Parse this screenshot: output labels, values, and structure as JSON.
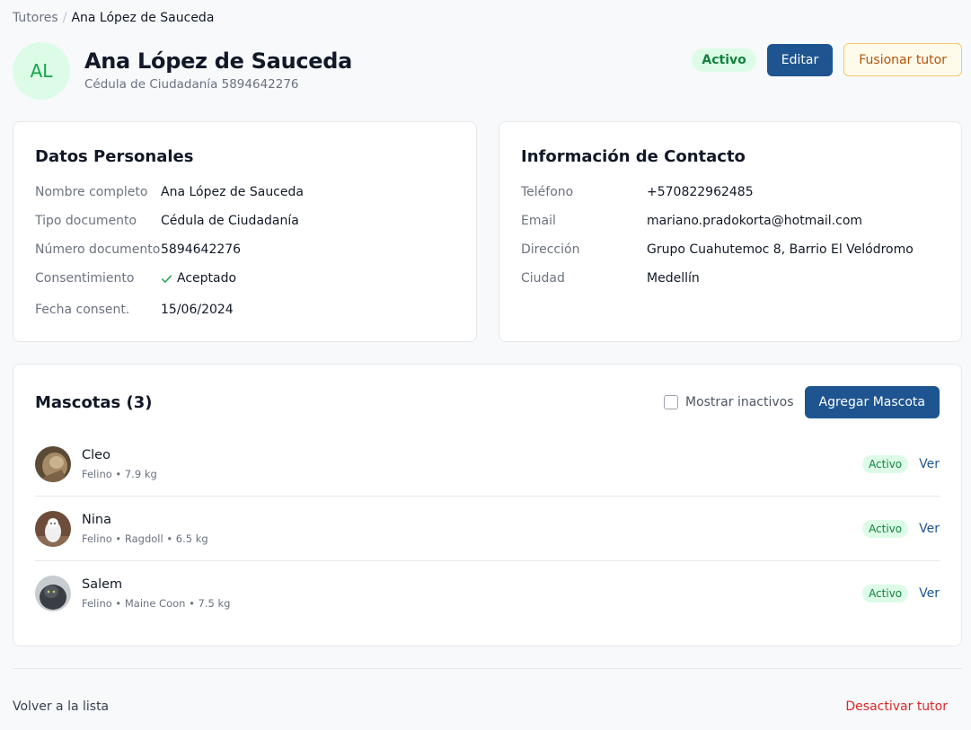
{
  "breadcrumb": {
    "parent": "Tutores",
    "separator": "/",
    "current": "Ana López de Sauceda"
  },
  "header": {
    "initials": "AL",
    "name": "Ana López de Sauceda",
    "subtitle": "Cédula de Ciudadanía 5894642276",
    "status": "Activo",
    "edit_label": "Editar",
    "merge_label": "Fusionar tutor"
  },
  "personal": {
    "title": "Datos Personales",
    "rows": [
      {
        "label": "Nombre completo",
        "value": "Ana López de Sauceda"
      },
      {
        "label": "Tipo documento",
        "value": "Cédula de Ciudadanía"
      },
      {
        "label": "Número documento",
        "value": "5894642276"
      },
      {
        "label": "Consentimiento",
        "value": "Aceptado"
      },
      {
        "label": "Fecha consent.",
        "value": "15/06/2024"
      }
    ]
  },
  "contact": {
    "title": "Información de Contacto",
    "rows": [
      {
        "label": "Teléfono",
        "value": "+570822962485"
      },
      {
        "label": "Email",
        "value": "mariano.pradokorta@hotmail.com"
      },
      {
        "label": "Dirección",
        "value": "Grupo Cuahutemoc 8, Barrio El Velódromo"
      },
      {
        "label": "Ciudad",
        "value": "Medellín"
      }
    ]
  },
  "pets": {
    "title": "Mascotas (3)",
    "show_inactive_label": "Mostrar inactivos",
    "add_label": "Agregar Mascota",
    "items": [
      {
        "name": "Cleo",
        "meta": "Felino • 7.9 kg",
        "status": "Activo",
        "action": "Ver"
      },
      {
        "name": "Nina",
        "meta": "Felino • Ragdoll • 6.5 kg",
        "status": "Activo",
        "action": "Ver"
      },
      {
        "name": "Salem",
        "meta": "Felino • Maine Coon • 7.5 kg",
        "status": "Activo",
        "action": "Ver"
      }
    ]
  },
  "footer": {
    "back_label": "Volver a la lista",
    "deactivate_label": "Desactivar tutor"
  },
  "colors": {
    "primary": "#1e5591",
    "success": "#16a34a",
    "danger": "#dc2626",
    "warning": "#b45309"
  }
}
